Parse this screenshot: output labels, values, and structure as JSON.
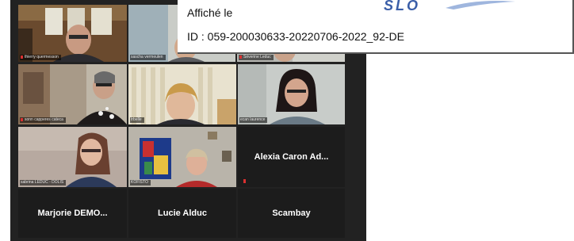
{
  "stamp": {
    "line1": "Affiché le",
    "line2": "ID : 059-200030633-20220706-2022_92-DE"
  },
  "logo": {
    "text": "SLO",
    "color": "#3a5ea8"
  },
  "meeting": {
    "background": "#222222",
    "video_tiles": [
      {
        "name": "thierry quermesson",
        "muted": true
      },
      {
        "name": "sascha vermeulen",
        "muted": false
      },
      {
        "name": "Séverine Leduc",
        "muted": true
      },
      {
        "name": "sonn capperes cateca",
        "muted": true
      },
      {
        "name": "trbelle",
        "muted": false,
        "active": true
      },
      {
        "name": "ecan laurence",
        "muted": false
      },
      {
        "name": "sabrina LEDUC - DOLIS",
        "muted": false
      },
      {
        "name": "KOFISTO",
        "muted": false
      }
    ],
    "name_tiles": [
      {
        "name": "Alexia Caron Ad...",
        "muted": true
      },
      {
        "name": "Marjorie DEMO...",
        "muted": false
      },
      {
        "name": "Lucie Alduc",
        "muted": false
      },
      {
        "name": "Scambay",
        "muted": false
      }
    ]
  }
}
